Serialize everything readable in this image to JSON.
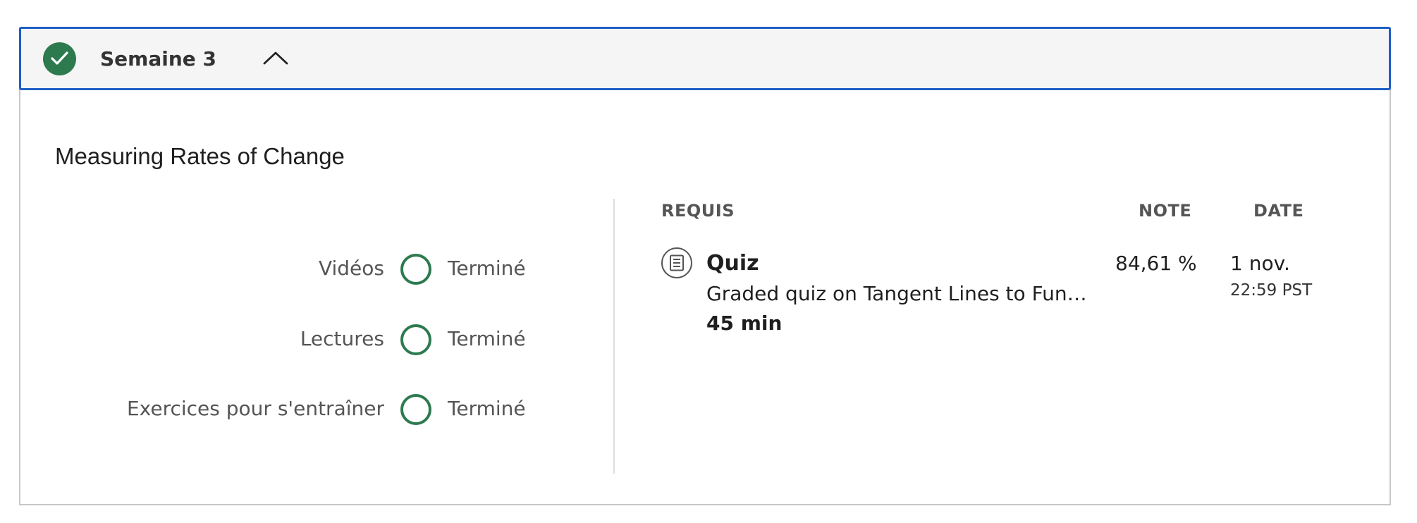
{
  "week": {
    "title": "Semaine 3",
    "completed": true,
    "expanded": true
  },
  "module": {
    "title": "Measuring Rates of Change"
  },
  "progress": [
    {
      "label": "Vidéos",
      "status": "Terminé"
    },
    {
      "label": "Lectures",
      "status": "Terminé"
    },
    {
      "label": "Exercices pour s'entraîner",
      "status": "Terminé"
    }
  ],
  "table": {
    "headers": {
      "required": "REQUIS",
      "grade": "NOTE",
      "date": "DATE"
    },
    "items": [
      {
        "icon": "quiz-icon",
        "type": "Quiz",
        "title": "Graded quiz on Tangent Lines to Functi...",
        "duration": "45 min",
        "grade": "84,61 %",
        "date": "1 nov.",
        "time": "22:59 PST"
      }
    ]
  },
  "colors": {
    "accent": "#1f5fc4",
    "success": "#2d7a4f",
    "header_bg": "#f5f5f5"
  }
}
